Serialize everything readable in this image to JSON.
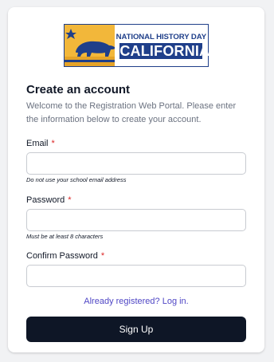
{
  "logo": {
    "line1": "NATIONAL HISTORY DAY",
    "line2": "CALIFORNIA",
    "colors": {
      "brand_blue": "#1f3f8a",
      "gold": "#f2b73a"
    }
  },
  "form": {
    "title": "Create an account",
    "intro": "Welcome to the Registration Web Portal. Please enter the information below to create your account.",
    "required_marker": "*",
    "email": {
      "label": "Email",
      "value": "",
      "hint": "Do not use your school email address"
    },
    "password": {
      "label": "Password",
      "value": "",
      "hint": "Must be at least 8 characters"
    },
    "confirm_password": {
      "label": "Confirm Password",
      "value": ""
    },
    "login_link": "Already registered? Log in.",
    "submit_label": "Sign Up"
  },
  "colors": {
    "submit_bg": "#0e1626",
    "link": "#4f46c5",
    "required": "#dc2626"
  }
}
